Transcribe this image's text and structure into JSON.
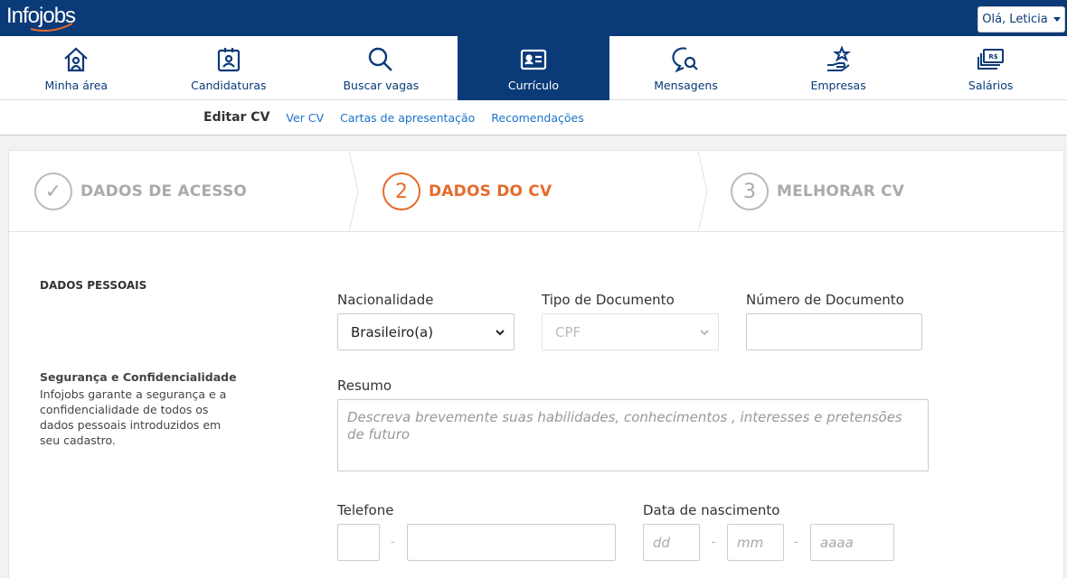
{
  "header": {
    "logo": "Infojobs",
    "user_greeting": "Olá, Leticia"
  },
  "nav": [
    {
      "label": "Minha área",
      "icon": "home-icon"
    },
    {
      "label": "Candidaturas",
      "icon": "badge-icon"
    },
    {
      "label": "Buscar vagas",
      "icon": "search-icon"
    },
    {
      "label": "Currículo",
      "icon": "id-card-icon",
      "active": true
    },
    {
      "label": "Mensagens",
      "icon": "chat-search-icon"
    },
    {
      "label": "Empresas",
      "icon": "hand-star-icon"
    },
    {
      "label": "Salários",
      "icon": "money-icon",
      "icon_text": "R$"
    }
  ],
  "subnav": {
    "current": "Editar CV",
    "links": [
      "Ver CV",
      "Cartas de apresentação",
      "Recomendações"
    ]
  },
  "steps": [
    {
      "number": "✓",
      "label": "DADOS DE ACESSO",
      "state": "done"
    },
    {
      "number": "2",
      "label": "DADOS DO CV",
      "state": "active"
    },
    {
      "number": "3",
      "label": "MELHORAR CV",
      "state": "pending"
    }
  ],
  "section": {
    "title": "DADOS PESSOAIS",
    "security_heading": "Segurança e Confidencialidade",
    "security_text": "Infojobs garante a segurança e a confidencialidade de todos os dados pessoais introduzidos em seu cadastro."
  },
  "form": {
    "nacionalidade": {
      "label": "Nacionalidade",
      "value": "Brasileiro(a)"
    },
    "tipo_documento": {
      "label": "Tipo de Documento",
      "value": "CPF"
    },
    "numero_documento": {
      "label": "Número de Documento",
      "value": ""
    },
    "resumo": {
      "label": "Resumo",
      "placeholder": "Descreva brevemente suas habilidades, conhecimentos , interesses e pretensões de futuro"
    },
    "telefone": {
      "label": "Telefone",
      "separator": "-"
    },
    "data_nascimento": {
      "label": "Data de nascimento",
      "dd": "dd",
      "mm": "mm",
      "aaaa": "aaaa",
      "separator": "-"
    }
  },
  "colors": {
    "brand": "#0a3a78",
    "accent": "#e56b2b",
    "link": "#1a73c9"
  }
}
